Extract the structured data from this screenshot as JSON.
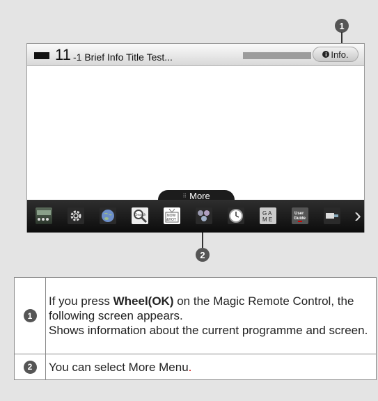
{
  "callouts": {
    "one": "1",
    "two": "2"
  },
  "tv": {
    "channel_number": "11",
    "channel_title": "-1 Brief Info Title Test...",
    "info_icon": "i",
    "info_label": "Info.",
    "more_label": "More"
  },
  "apps": [
    {
      "icon": "input-device-icon"
    },
    {
      "icon": "settings-gear-icon"
    },
    {
      "icon": "globe-icon"
    },
    {
      "icon": "search-icon",
      "label": "Search"
    },
    {
      "icon": "now-and-hot-icon",
      "label": "NOW &HOT"
    },
    {
      "icon": "smartshare-icon"
    },
    {
      "icon": "clock-icon"
    },
    {
      "icon": "game-icon",
      "label": "G A M E"
    },
    {
      "icon": "user-guide-icon",
      "label": "User Guide"
    },
    {
      "icon": "device-connector-icon"
    }
  ],
  "table": {
    "rows": [
      {
        "marker": "1",
        "pre": "If you press ",
        "bold": "Wheel(OK)",
        "post": " on the Magic Remote Control, the following screen appears.",
        "line2": "Shows information about the current programme and screen."
      },
      {
        "marker": "2",
        "text": "You can select More Menu",
        "period": "."
      }
    ]
  },
  "colors": {
    "background": "#e4e4e4",
    "bar": "#1c1c1c",
    "accent_period": "#cc0000"
  }
}
